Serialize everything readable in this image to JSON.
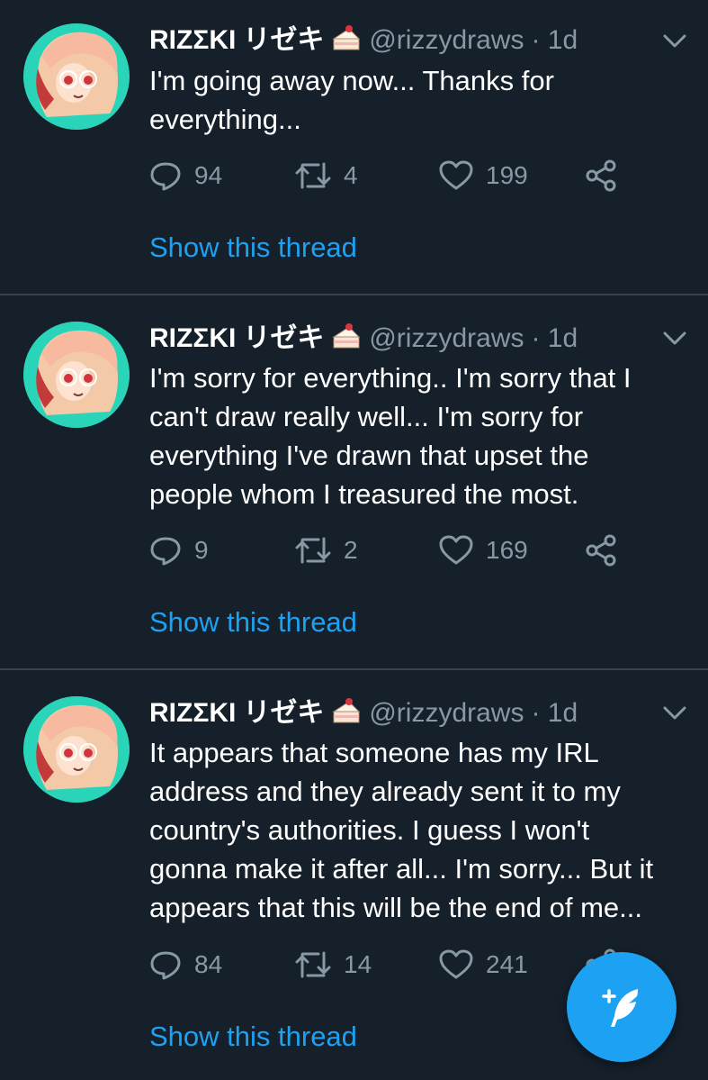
{
  "colors": {
    "background": "#15202b",
    "divider": "#38444d",
    "text": "#ffffff",
    "muted": "#8899a6",
    "accent": "#1da1f2"
  },
  "tweets": [
    {
      "name": "RIZΣKI",
      "name_jp": "リゼキ",
      "emoji": "cake-icon",
      "handle": "@rizzydraws",
      "time": "· 1d",
      "lines": [
        "I'm going away now... Thanks for",
        "everything..."
      ],
      "replies": "94",
      "retweets": "4",
      "likes": "199",
      "show_thread": "Show this thread"
    },
    {
      "name": "RIZΣKI",
      "name_jp": "リゼキ",
      "emoji": "cake-icon",
      "handle": "@rizzydraws",
      "time": "· 1d",
      "lines": [
        "I'm sorry for everything..  I'm sorry that I",
        "can't draw really well... I'm sorry for",
        "everything I've drawn that upset the",
        "people whom I treasured the most."
      ],
      "replies": "9",
      "retweets": "2",
      "likes": "169",
      "show_thread": "Show this thread"
    },
    {
      "name": "RIZΣKI",
      "name_jp": "リゼキ",
      "emoji": "cake-icon",
      "handle": "@rizzydraws",
      "time": "· 1d",
      "lines": [
        "It appears that someone has my IRL",
        "address and they already sent it to my",
        "country's authorities. I guess I won't",
        "gonna make it after all... I'm sorry... But it",
        "appears that this will be the end of me..."
      ],
      "replies": "84",
      "retweets": "14",
      "likes": "241",
      "show_thread": "Show this thread"
    }
  ],
  "fab": {
    "icon": "compose-tweet-icon"
  }
}
